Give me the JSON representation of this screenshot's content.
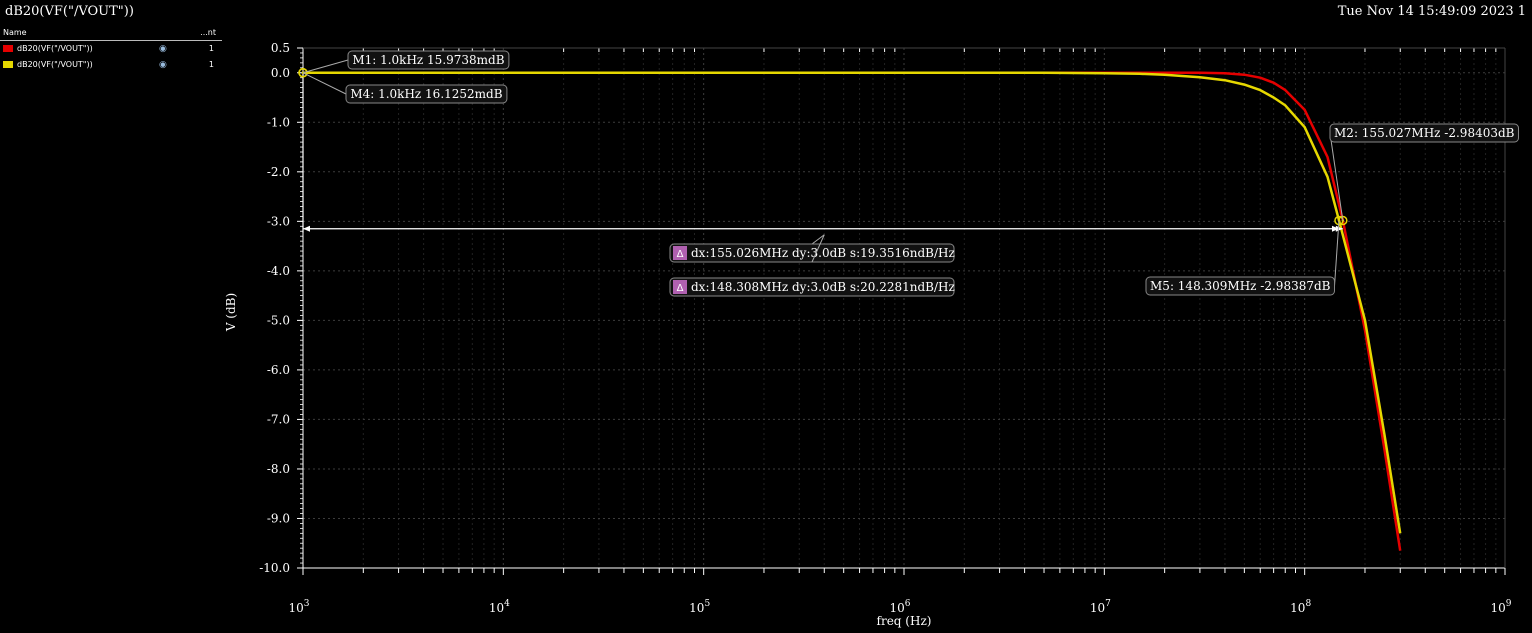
{
  "window": {
    "title": "dB20(VF(\"/VOUT\"))",
    "timestamp": "Tue Nov 14 15:49:09 2023  1"
  },
  "legend": {
    "header_name": "Name",
    "header_count": "...nt",
    "items": [
      {
        "label": "dB20(VF(\"/VOUT\"))",
        "count": "1",
        "color": "#e60000"
      },
      {
        "label": "dB20(VF(\"/VOUT\"))",
        "count": "1",
        "color": "#e6d800"
      }
    ]
  },
  "chart_data": {
    "type": "line",
    "xlabel": "freq (Hz)",
    "ylabel": "V (dB)",
    "xscale": "log",
    "xlim": [
      1000,
      1000000000
    ],
    "ylim": [
      -10,
      0.5
    ],
    "x_ticks": [
      {
        "base": "10",
        "exp": "3"
      },
      {
        "base": "10",
        "exp": "4"
      },
      {
        "base": "10",
        "exp": "5"
      },
      {
        "base": "10",
        "exp": "6"
      },
      {
        "base": "10",
        "exp": "7"
      },
      {
        "base": "10",
        "exp": "8"
      },
      {
        "base": "10",
        "exp": "9"
      }
    ],
    "y_ticks": [
      "0.5",
      "0.0",
      "-1.0",
      "-2.0",
      "-3.0",
      "-4.0",
      "-5.0",
      "-6.0",
      "-7.0",
      "-8.0",
      "-9.0",
      "-10.0"
    ],
    "grid": true,
    "series": [
      {
        "color": "#e60000",
        "x": [
          1000,
          10000000,
          20000000,
          30000000,
          40000000,
          50000000,
          60000000,
          70000000,
          80000000,
          100000000,
          130000000,
          155027000,
          200000000,
          250000000,
          300000000
        ],
        "y": [
          0,
          0,
          0,
          0,
          -0.01,
          -0.04,
          -0.1,
          -0.2,
          -0.35,
          -0.75,
          -1.7,
          -2.98,
          -5.2,
          -7.6,
          -9.65
        ]
      },
      {
        "color": "#e6d800",
        "x": [
          1000,
          5000000,
          10000000,
          15000000,
          20000000,
          30000000,
          40000000,
          50000000,
          60000000,
          70000000,
          80000000,
          100000000,
          130000000,
          148309000,
          200000000,
          250000000,
          300000000
        ],
        "y": [
          0,
          0,
          -0.01,
          -0.02,
          -0.04,
          -0.09,
          -0.15,
          -0.24,
          -0.35,
          -0.5,
          -0.66,
          -1.1,
          -2.1,
          -2.98,
          -5.0,
          -7.3,
          -9.3
        ]
      }
    ],
    "markers": [
      {
        "label": "M1: 1.0kHz 15.9738mdB",
        "x": 1000,
        "y": 0
      },
      {
        "label": "M4: 1.0kHz 16.1252mdB",
        "x": 1000,
        "y": 0
      },
      {
        "label": "M2: 155.027MHz -2.98403dB",
        "x": 155027000,
        "y": -2.98403
      },
      {
        "label": "M5: 148.309MHz -2.98387dB",
        "x": 148309000,
        "y": -2.98387
      }
    ],
    "deltas": [
      {
        "label": "dx:155.026MHz dy:3.0dB s:19.3516ndB/Hz"
      },
      {
        "label": "dx:148.308MHz dy:3.0dB s:20.2281ndB/Hz"
      }
    ]
  }
}
